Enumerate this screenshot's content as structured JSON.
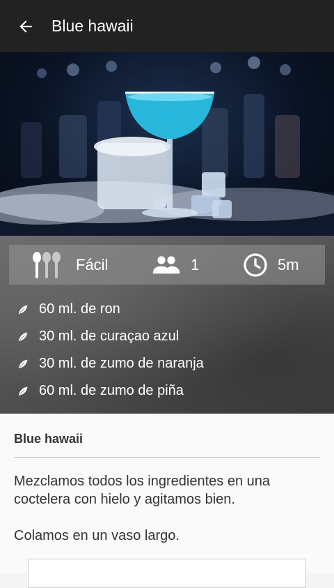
{
  "appbar": {
    "title": "Blue hawaii",
    "back_icon": "arrow-left-icon"
  },
  "stats": {
    "difficulty": "Fácil",
    "servings": "1",
    "time": "5m",
    "icons": [
      "cutlery-icon",
      "people-icon",
      "clock-icon"
    ]
  },
  "ingredients": [
    "60 ml. de ron",
    "30 ml. de curaçao azul",
    "30 ml. de zumo de naranja",
    "60 ml. de zumo de piña"
  ],
  "card": {
    "title": "Blue hawaii",
    "paragraphs": [
      "Mezclamos todos los ingredientes en una coctelera con hielo y agitamos bien.",
      "Colamos en un vaso largo."
    ]
  },
  "colors": {
    "appbar": "#222222",
    "cocktail": "#29c3e8"
  }
}
